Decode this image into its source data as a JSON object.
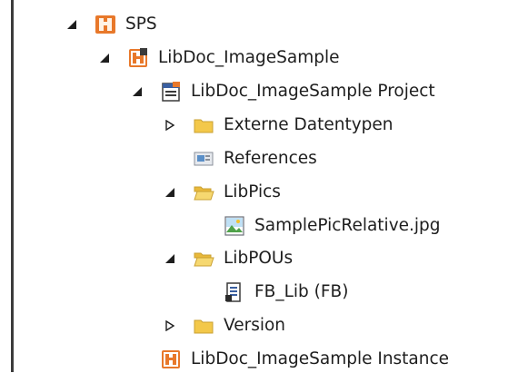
{
  "tree": {
    "nodes": [
      {
        "label": "SPS",
        "toggle": "expanded",
        "icon": "plc-icon"
      },
      {
        "label": "LibDoc_ImageSample",
        "toggle": "expanded",
        "icon": "plc-project-icon"
      },
      {
        "label": "LibDoc_ImageSample Project",
        "toggle": "expanded",
        "icon": "project-icon"
      },
      {
        "label": "Externe Datentypen",
        "toggle": "collapsed",
        "icon": "folder-icon"
      },
      {
        "label": "References",
        "toggle": "none",
        "icon": "references-icon"
      },
      {
        "label": "LibPics",
        "toggle": "expanded",
        "icon": "folder-open-icon"
      },
      {
        "label": "SamplePicRelative.jpg",
        "toggle": "none",
        "icon": "image-file-icon"
      },
      {
        "label": "LibPOUs",
        "toggle": "expanded",
        "icon": "folder-open-icon"
      },
      {
        "label": "FB_Lib (FB)",
        "toggle": "none",
        "icon": "function-block-icon"
      },
      {
        "label": "Version",
        "toggle": "collapsed",
        "icon": "folder-icon"
      },
      {
        "label": "LibDoc_ImageSample Instance",
        "toggle": "none",
        "icon": "plc-instance-icon"
      }
    ]
  },
  "colors": {
    "text": "#1e1e1e",
    "arrow": "#1e1e1e",
    "folder": "#f3c84a",
    "plc_orange": "#e8782a",
    "border": "#3c3c3c"
  }
}
